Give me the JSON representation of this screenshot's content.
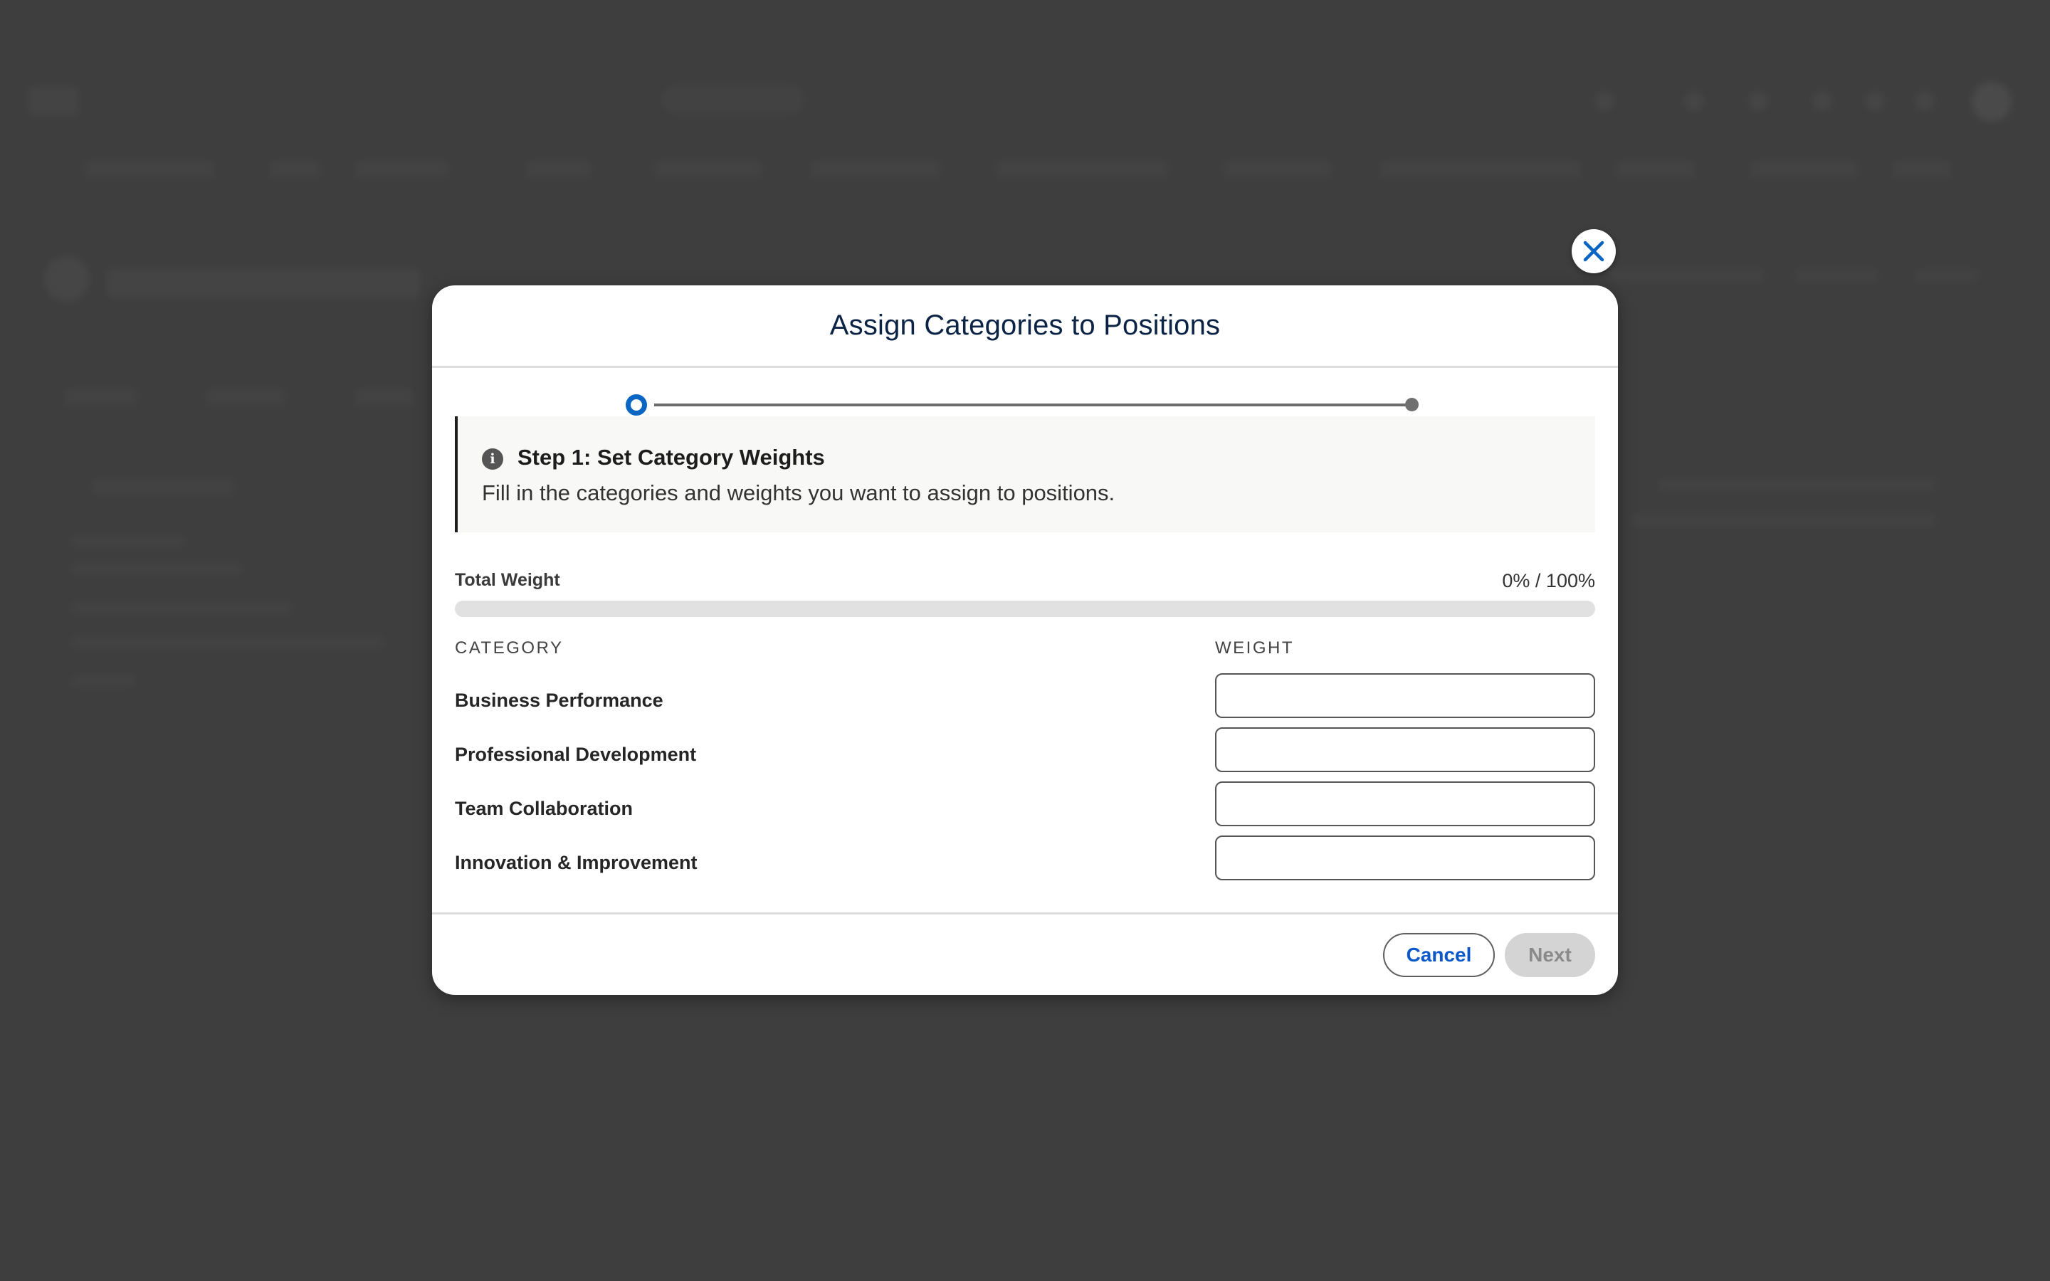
{
  "modal": {
    "title": "Assign Categories to Positions",
    "stepper": {
      "current_step": 1,
      "total_steps": 2
    },
    "info": {
      "icon": "info-icon",
      "title": "Step 1: Set Category Weights",
      "description": "Fill in the categories and weights you want to assign to positions."
    },
    "total_weight": {
      "label": "Total Weight",
      "value": "0% / 100%",
      "progress_fraction": 0
    },
    "table": {
      "headers": {
        "category": "CATEGORY",
        "weight": "WEIGHT"
      },
      "rows": [
        {
          "category": "Business Performance",
          "weight": ""
        },
        {
          "category": "Professional Development",
          "weight": ""
        },
        {
          "category": "Team Collaboration",
          "weight": ""
        },
        {
          "category": "Innovation & Improvement",
          "weight": ""
        }
      ]
    },
    "footer": {
      "cancel_label": "Cancel",
      "next_label": "Next",
      "next_disabled": true
    },
    "close_icon": "close-icon"
  },
  "colors": {
    "accent": "#0a66c2",
    "overlay": "#3e3e3e",
    "title": "#0b2344",
    "disabled_button": "#d4d4d4"
  }
}
